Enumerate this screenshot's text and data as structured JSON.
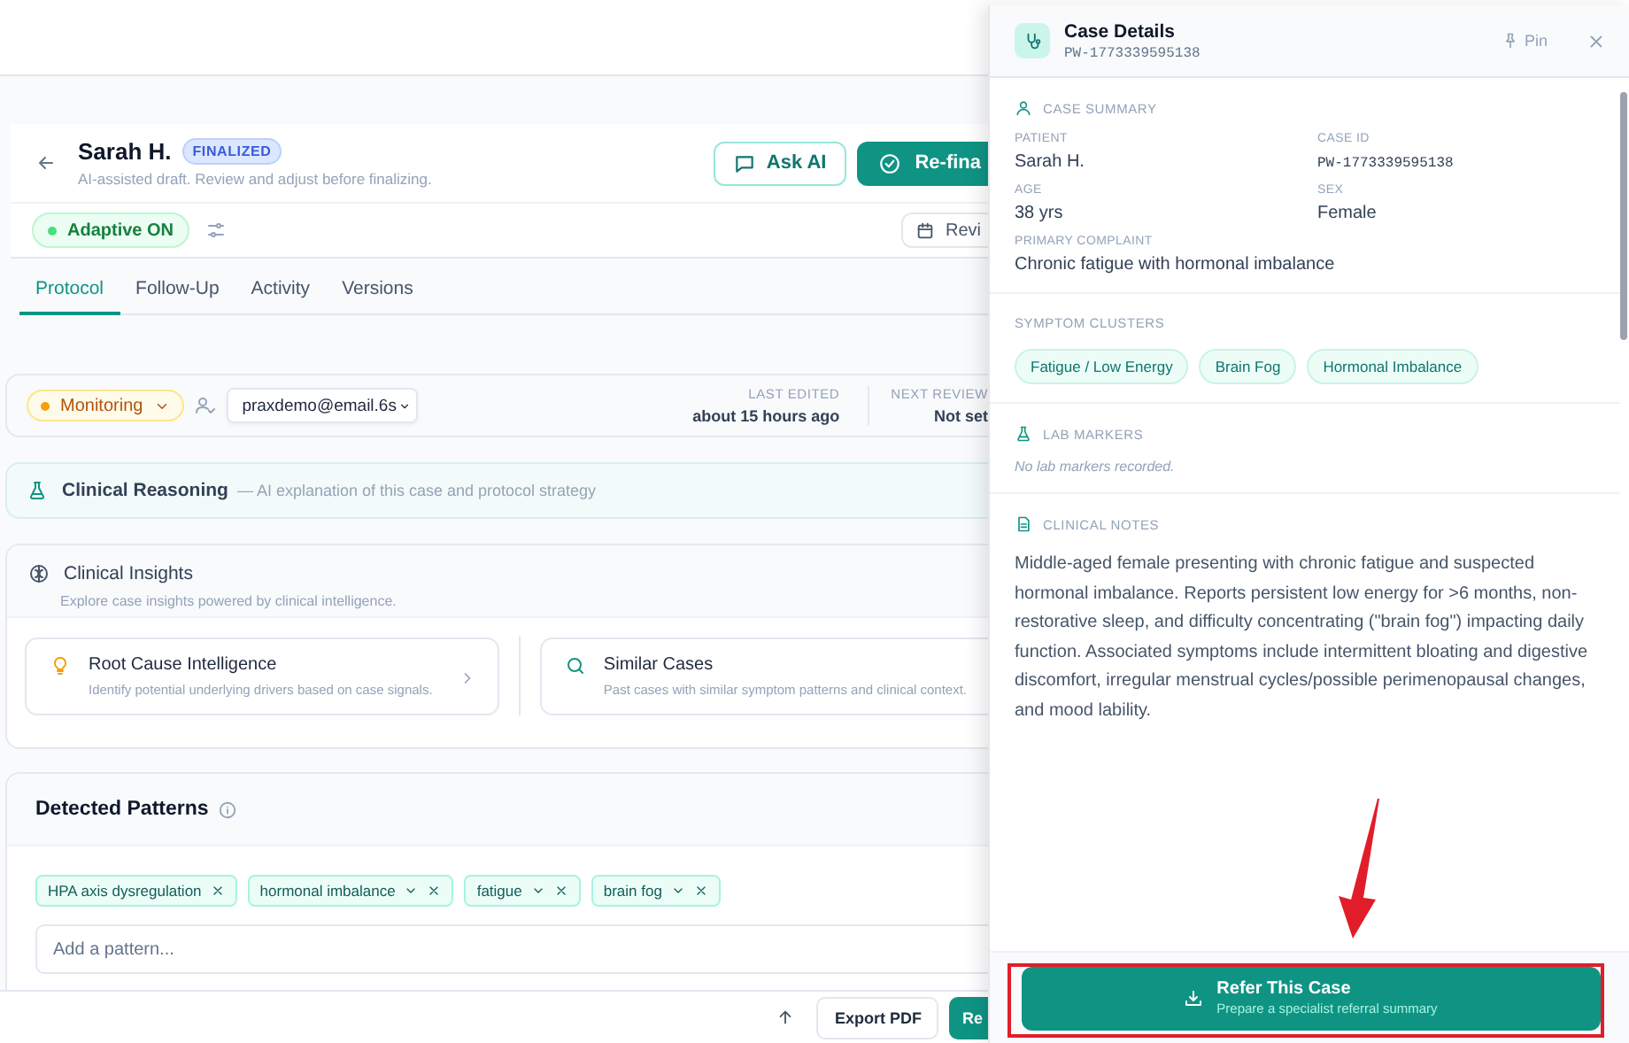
{
  "header": {
    "patient_name": "Sarah H.",
    "status_badge": "FINALIZED",
    "subtitle": "AI-assisted draft. Review and adjust before finalizing.",
    "buttons": [
      {
        "label": "Ask AI",
        "kind": "outline"
      },
      {
        "label": "Re-fina",
        "kind": "primary"
      }
    ]
  },
  "adaptive": {
    "label": "Adaptive ON",
    "on": true
  },
  "review_button": {
    "label": "Revi"
  },
  "tabs": [
    {
      "label": "Protocol",
      "selected": true
    },
    {
      "label": "Follow-Up",
      "selected": false
    },
    {
      "label": "Activity",
      "selected": false
    },
    {
      "label": "Versions",
      "selected": false
    }
  ],
  "status": {
    "label": "Monitoring",
    "assignee": "praxdemo@email.6s",
    "meta": [
      {
        "label": "LAST EDITED",
        "value": "about 15 hours ago"
      },
      {
        "label": "NEXT REVIEW",
        "value": "Not set"
      }
    ]
  },
  "clinical_reasoning": {
    "title": "Clinical Reasoning",
    "description": "— AI explanation of this case and protocol strategy"
  },
  "clinical_insights": {
    "title": "Clinical Insights",
    "subtitle": "Explore case insights powered by clinical intelligence.",
    "cards": [
      {
        "kind": "bulb",
        "title": "Root Cause Intelligence",
        "description": "Identify potential underlying drivers based on case signals."
      },
      {
        "kind": "search",
        "title": "Similar Cases",
        "description": "Past cases with similar symptom patterns and clinical context."
      }
    ]
  },
  "detected_patterns": {
    "title": "Detected Patterns",
    "tags": [
      {
        "label": "HPA axis dysregulation",
        "expandable": false
      },
      {
        "label": "hormonal imbalance",
        "expandable": true
      },
      {
        "label": "fatigue",
        "expandable": true
      },
      {
        "label": "brain fog",
        "expandable": true
      }
    ],
    "input": {
      "placeholder": "Add a pattern..."
    }
  },
  "bottom_bar": {
    "buttons": [
      {
        "label": "Export PDF",
        "kind": "outline"
      },
      {
        "label": "Re",
        "kind": "primary"
      }
    ]
  },
  "panel": {
    "title": "Case Details",
    "case_id": "PW-1773339595138",
    "pin": "Pin",
    "case_summary": {
      "heading": "CASE SUMMARY",
      "fields": [
        {
          "label": "PATIENT",
          "value": "Sarah H.",
          "kind": "text"
        },
        {
          "label": "CASE ID",
          "value": "PW-1773339595138",
          "kind": "mono"
        },
        {
          "label": "AGE",
          "value": "38 yrs",
          "kind": "text"
        },
        {
          "label": "SEX",
          "value": "Female",
          "kind": "text"
        },
        {
          "label": "PRIMARY COMPLAINT",
          "value": "Chronic fatigue with hormonal imbalance",
          "kind": "wide"
        }
      ]
    },
    "symptom_clusters": {
      "heading": "SYMPTOM CLUSTERS",
      "tags": [
        "Fatigue / Low Energy",
        "Brain Fog",
        "Hormonal Imbalance"
      ]
    },
    "lab_markers": {
      "heading": "LAB MARKERS",
      "empty": "No lab markers recorded."
    },
    "clinical_notes": {
      "heading": "CLINICAL NOTES",
      "text": "Middle-aged female presenting with chronic fatigue and suspected hormonal imbalance. Reports persistent low energy for >6 months, non-restorative sleep, and difficulty concentrating (\"brain fog\") impacting daily function. Associated symptoms include intermittent bloating and digestive discomfort, irregular menstrual cycles/possible perimenopausal changes, and mood lability."
    },
    "refer_button": {
      "label": "Refer This Case",
      "sublabel": "Prepare a specialist referral summary"
    }
  }
}
